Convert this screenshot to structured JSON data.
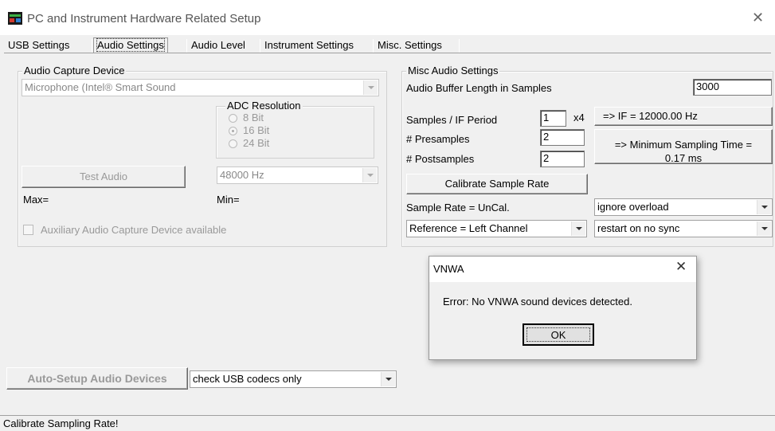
{
  "window": {
    "title": "PC and Instrument Hardware Related Setup"
  },
  "tabs": [
    {
      "label": "USB Settings"
    },
    {
      "label": "Audio Settings"
    },
    {
      "label": "Audio Level"
    },
    {
      "label": "Instrument Settings"
    },
    {
      "label": "Misc. Settings"
    }
  ],
  "audio_capture": {
    "group_label": "Audio Capture Device",
    "device": "Microphone (Intel® Smart Sound",
    "adc_group_label": "ADC Resolution",
    "adc_options": [
      "8 Bit",
      "16 Bit",
      "24 Bit"
    ],
    "adc_selected": "16 Bit",
    "test_audio_label": "Test Audio",
    "sample_rate": "48000 Hz",
    "max_label": "Max=",
    "min_label": "Min=",
    "aux_label": "Auxiliary Audio Capture Device available"
  },
  "misc_audio": {
    "group_label": "Misc Audio Settings",
    "buffer_label": "Audio Buffer Length in Samples",
    "buffer_value": "3000",
    "samples_if_label": "Samples / IF Period",
    "samples_if_value": "1",
    "multiplier": "x4",
    "if_result": "=> IF =   12000.00 Hz",
    "presamples_label": "# Presamples",
    "presamples_value": "2",
    "postsamples_label": "# Postsamples",
    "postsamples_value": "2",
    "min_sampling_line1": "=> Minimum Sampling Time =",
    "min_sampling_line2": "0.17 ms",
    "calibrate_label": "Calibrate Sample Rate",
    "sample_rate_label": "Sample Rate = UnCal.",
    "overload_option": "ignore overload",
    "reference_option": "Reference = Left Channel",
    "sync_option": "restart on no sync"
  },
  "auto_setup": {
    "button_label": "Auto-Setup Audio Devices",
    "codec_option": "check USB codecs only"
  },
  "dialog": {
    "title": "VNWA",
    "message": "Error: No VNWA sound devices detected.",
    "ok_label": "OK"
  },
  "status_bar": {
    "text": "Calibrate Sampling Rate!"
  },
  "colors": {
    "dialog_bg": "#f0f0f0",
    "window_bg": "#f0f0f0",
    "disabled_text": "#999999"
  }
}
